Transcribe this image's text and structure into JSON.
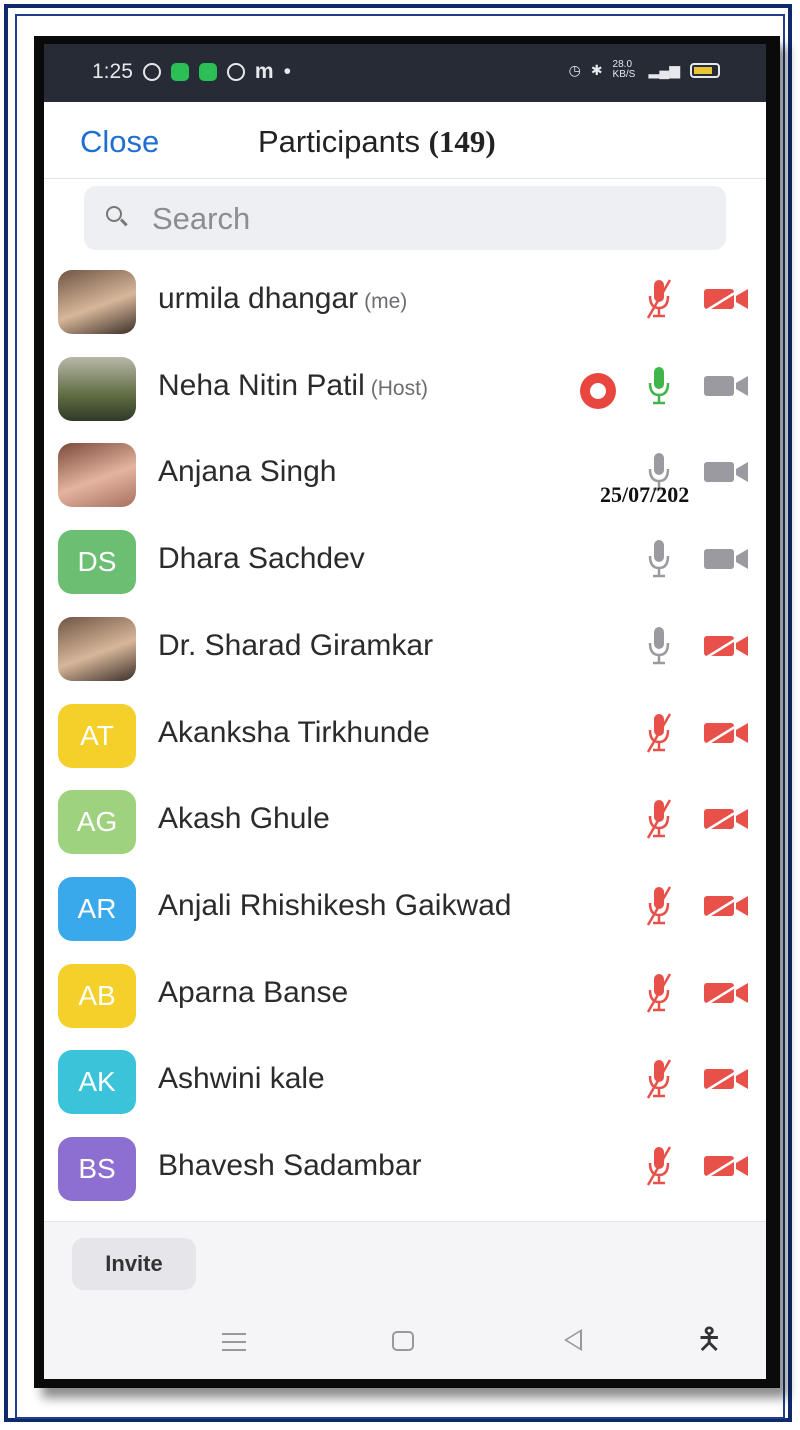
{
  "status_bar": {
    "time": "1:25",
    "app_letter": "m",
    "network_speed": "28.0 KB/S"
  },
  "header": {
    "close_label": "Close",
    "title": "Participants",
    "count": "(149)"
  },
  "search": {
    "placeholder": "Search"
  },
  "participants": [
    {
      "name": "urmila dhangar",
      "tag": "(me)",
      "avatar": "photo",
      "mic": "muted",
      "video": "off"
    },
    {
      "name": "Neha Nitin Patil",
      "tag": "(Host)",
      "avatar": "photo",
      "recording": true,
      "mic": "active",
      "video": "on"
    },
    {
      "name": "Anjana Singh",
      "tag": "",
      "avatar": "photo",
      "mic": "unmuted",
      "video": "on"
    },
    {
      "name": "Dhara Sachdev",
      "tag": "",
      "initials": "DS",
      "color": "#6cbf72",
      "mic": "unmuted",
      "video": "on"
    },
    {
      "name": "Dr. Sharad Giramkar",
      "tag": "",
      "avatar": "photo",
      "mic": "unmuted",
      "video": "off"
    },
    {
      "name": "Akanksha Tirkhunde",
      "tag": "",
      "initials": "AT",
      "color": "#f5d02a",
      "mic": "muted",
      "video": "off"
    },
    {
      "name": "Akash Ghule",
      "tag": "",
      "initials": "AG",
      "color": "#9fd27e",
      "mic": "muted",
      "video": "off"
    },
    {
      "name": "Anjali Rhishikesh Gaikwad",
      "tag": "",
      "initials": "AR",
      "color": "#3aa9ec",
      "mic": "muted",
      "video": "off"
    },
    {
      "name": "Aparna Banse",
      "tag": "",
      "initials": "AB",
      "color": "#f5d02a",
      "mic": "muted",
      "video": "off"
    },
    {
      "name": "Ashwini kale",
      "tag": "",
      "initials": "AK",
      "color": "#3bc4d9",
      "mic": "muted",
      "video": "off"
    },
    {
      "name": "Bhavesh Sadambar",
      "tag": "",
      "initials": "BS",
      "color": "#8c6fd0",
      "mic": "muted",
      "video": "off"
    }
  ],
  "overlay_date": "25/07/202",
  "footer": {
    "invite_label": "Invite"
  },
  "colors": {
    "accent": "#1f6fd0",
    "muted_red": "#e8504a",
    "active_green": "#3fb54a",
    "icon_gray": "#9a9aa0"
  }
}
